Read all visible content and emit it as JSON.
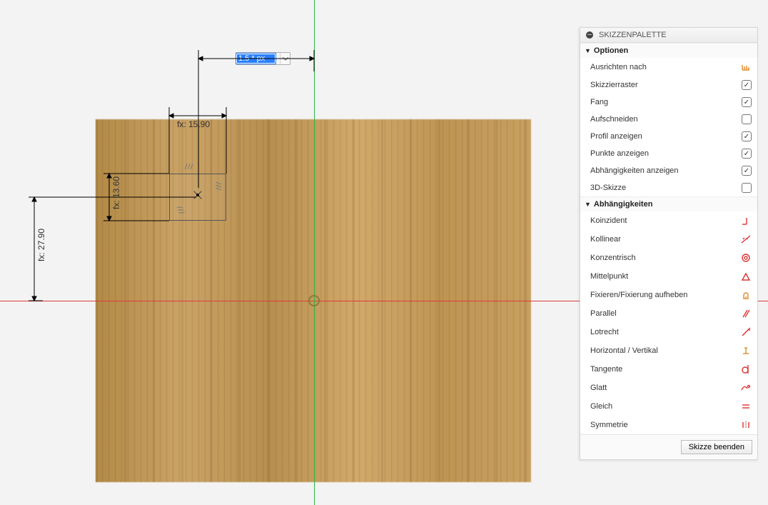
{
  "palette": {
    "title": "SKIZZENPALETTE",
    "sections": {
      "options": {
        "title": "Optionen",
        "items": [
          {
            "key": "align",
            "label": "Ausrichten nach",
            "ctrl": "icon"
          },
          {
            "key": "grid",
            "label": "Skizzierraster",
            "ctrl": "checkbox",
            "checked": true
          },
          {
            "key": "snap",
            "label": "Fang",
            "ctrl": "checkbox",
            "checked": true
          },
          {
            "key": "slice",
            "label": "Aufschneiden",
            "ctrl": "checkbox",
            "checked": false
          },
          {
            "key": "profile",
            "label": "Profil anzeigen",
            "ctrl": "checkbox",
            "checked": true
          },
          {
            "key": "points",
            "label": "Punkte anzeigen",
            "ctrl": "checkbox",
            "checked": true
          },
          {
            "key": "constr",
            "label": "Abhängigkeiten anzeigen",
            "ctrl": "checkbox",
            "checked": true
          },
          {
            "key": "sk3d",
            "label": "3D-Skizze",
            "ctrl": "checkbox",
            "checked": false
          }
        ]
      },
      "constraints": {
        "title": "Abhängigkeiten",
        "items": [
          {
            "key": "coinc",
            "label": "Koinzident",
            "icon": "coincident"
          },
          {
            "key": "collin",
            "label": "Kollinear",
            "icon": "collinear"
          },
          {
            "key": "concen",
            "label": "Konzentrisch",
            "icon": "concentric"
          },
          {
            "key": "midpt",
            "label": "Mittelpunkt",
            "icon": "midpoint"
          },
          {
            "key": "fix",
            "label": "Fixieren/Fixierung aufheben",
            "icon": "fix"
          },
          {
            "key": "para",
            "label": "Parallel",
            "icon": "parallel"
          },
          {
            "key": "perp",
            "label": "Lotrecht",
            "icon": "perpend"
          },
          {
            "key": "hv",
            "label": "Horizontal / Vertikal",
            "icon": "horizvert"
          },
          {
            "key": "tang",
            "label": "Tangente",
            "icon": "tangent"
          },
          {
            "key": "smooth",
            "label": "Glatt",
            "icon": "smooth"
          },
          {
            "key": "equal",
            "label": "Gleich",
            "icon": "equal"
          },
          {
            "key": "symm",
            "label": "Symmetrie",
            "icon": "symmetry"
          }
        ]
      }
    },
    "footer_button": "Skizze beenden"
  },
  "dimensions": {
    "top": "fx: 15.90",
    "left1": "fx: 13.60",
    "left2": "fx: 27.90"
  },
  "input": {
    "value": "1.5 * px",
    "unit": ""
  }
}
